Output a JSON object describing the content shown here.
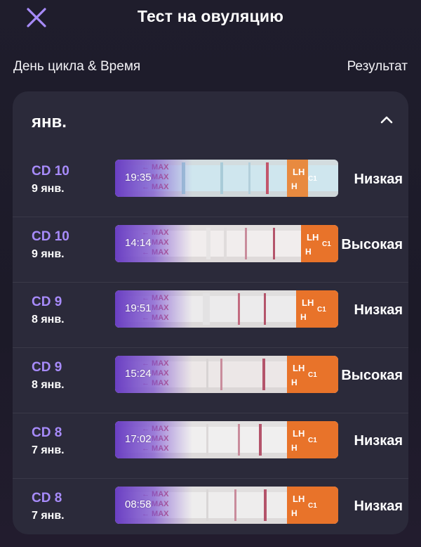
{
  "header": {
    "title": "Тест на овуляцию"
  },
  "columns": {
    "left": "День цикла & Время",
    "right": "Результат"
  },
  "month": {
    "label": "янв."
  },
  "strip_text": {
    "max": "MAX",
    "lh": "LH",
    "c1": "C1",
    "h": "H"
  },
  "colors": {
    "accent": "#a78bfa",
    "card": "#2b2a3a",
    "strip_orange": "#e8732a",
    "strip_purple": "#7c4dd6"
  },
  "rows": [
    {
      "cd": "CD 10",
      "date": "9 янв.",
      "time": "19:35",
      "result": "Низкая"
    },
    {
      "cd": "CD 10",
      "date": "9 янв.",
      "time": "14:14",
      "result": "Высокая"
    },
    {
      "cd": "CD 9",
      "date": "8 янв.",
      "time": "19:51",
      "result": "Низкая"
    },
    {
      "cd": "CD 9",
      "date": "8 янв.",
      "time": "15:24",
      "result": "Высокая"
    },
    {
      "cd": "CD 8",
      "date": "7 янв.",
      "time": "17:02",
      "result": "Низкая"
    },
    {
      "cd": "CD 8",
      "date": "7 янв.",
      "time": "08:58",
      "result": "Низкая"
    }
  ]
}
